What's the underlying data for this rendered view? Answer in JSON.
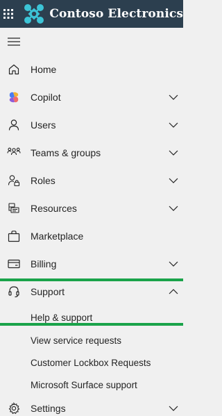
{
  "app": {
    "brand_name": "Contoso Electronics"
  },
  "nav": {
    "items": [
      {
        "label": "Home",
        "icon": "home-icon",
        "chevron": "none"
      },
      {
        "label": "Copilot",
        "icon": "copilot-icon",
        "chevron": "down"
      },
      {
        "label": "Users",
        "icon": "user-icon",
        "chevron": "down"
      },
      {
        "label": "Teams & groups",
        "icon": "people-team-icon",
        "chevron": "down"
      },
      {
        "label": "Roles",
        "icon": "person-lock-icon",
        "chevron": "down"
      },
      {
        "label": "Resources",
        "icon": "resources-icon",
        "chevron": "down"
      },
      {
        "label": "Marketplace",
        "icon": "shopping-bag-icon",
        "chevron": "none"
      },
      {
        "label": "Billing",
        "icon": "credit-card-icon",
        "chevron": "down"
      },
      {
        "label": "Support",
        "icon": "headset-icon",
        "chevron": "up"
      }
    ],
    "support_subitems": [
      {
        "label": "Help & support"
      },
      {
        "label": "View service requests"
      },
      {
        "label": "Customer Lockbox Requests"
      },
      {
        "label": "Microsoft Surface support"
      }
    ],
    "settings": {
      "label": "Settings",
      "icon": "gear-icon",
      "chevron": "down"
    }
  },
  "colors": {
    "topbar_bg": "#2c3f4f",
    "sidebar_bg": "#f0f0f0",
    "highlight_line": "#1aa34a",
    "logo_accent": "#3cc4d6"
  }
}
